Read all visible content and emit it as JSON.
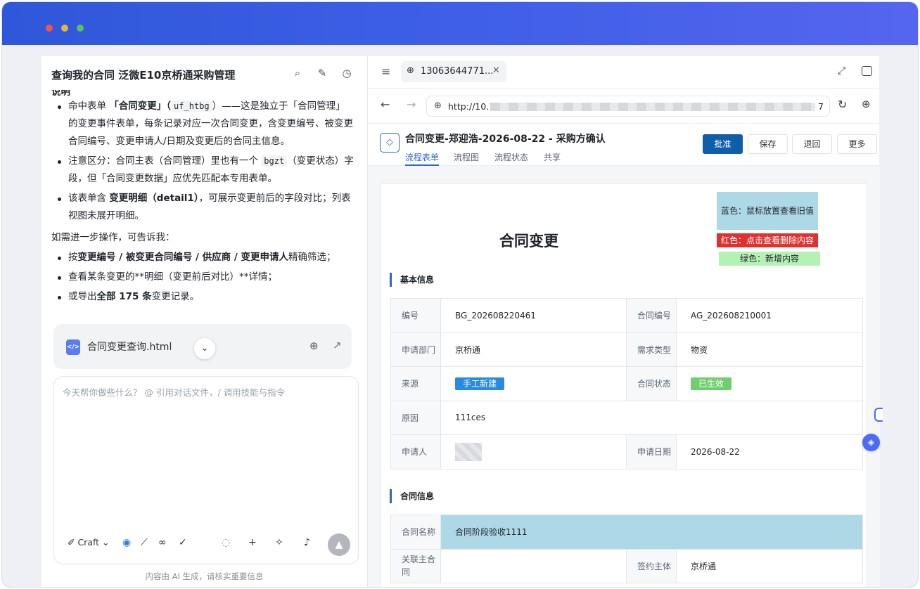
{
  "left_panel": {
    "title": "查询我的合同 泛微E10京桥通采购管理",
    "cut_heading": "说明",
    "bullets1": [
      {
        "pre": "命中表单 ",
        "bold": "「合同变更」（",
        "code": "uf_htbg",
        "post": "）——这是独立于「合同管理」的变更事件表单，每条记录对应一次合同变更，含变更编号、被变更合同编号、变更申请人/日期及变更后的合同主信息。"
      },
      {
        "pre": "注意区分：合同主表（合同管理）里也有一个 ",
        "code": "bgzt",
        "post": "（变更状态）字段，但「合同变更数据」应优先匹配本专用表单。"
      },
      {
        "pre": "该表单含 ",
        "bold": "变更明细（detail1）",
        "post": "，可展示变更前后的字段对比；列表视图未展开明细。"
      }
    ],
    "followup_intro": "如需进一步操作，可告诉我：",
    "bullets2": [
      {
        "pre": "按",
        "bold": "变更编号 / 被变更合同编号 / 供应商 / 变更申请人",
        "post": "精确筛选；"
      },
      {
        "pre": "查看某条变更的**明细（变更前后对比）**详情；",
        "bold": "",
        "post": ""
      },
      {
        "pre": "或导出",
        "bold": "全部 175 条",
        "post": "变更记录。"
      }
    ],
    "file_card": {
      "name": "合同变更查询.html",
      "icon": "code-file-icon"
    },
    "input_placeholder": "今天帮你做些什么？ @ 引用对话文件，/ 调用技能与指令",
    "mode_label": "Craft",
    "disclaimer": "内容由 AI 生成，请核实重要信息"
  },
  "browser": {
    "tab_label": "13063644771...",
    "url_start": "http://10.1",
    "url_end": "7"
  },
  "form": {
    "title": "合同变更-郑迎浩-2026-08-22 - 采购方确认",
    "tabs": [
      "流程表单",
      "流程图",
      "流程状态",
      "共享"
    ],
    "buttons": {
      "approve": "批准",
      "save": "保存",
      "return": "退回",
      "more": "更多"
    },
    "doc_title": "合同变更",
    "legend": {
      "blue": "蓝色：鼠标放置查看旧值",
      "red": "红色：点击查看删除内容",
      "green": "绿色：新增内容"
    },
    "section_basic": "基本信息",
    "basic": {
      "code_label": "编号",
      "code_value": "BG_202608220461",
      "contract_no_label": "合同编号",
      "contract_no_value": "AG_202608210001",
      "dept_label": "申请部门",
      "dept_value": "京桥通",
      "demand_label": "需求类型",
      "demand_value": "物资",
      "source_label": "来源",
      "source_value": "手工新建",
      "status_label": "合同状态",
      "status_value": "已生效",
      "reason_label": "原因",
      "reason_value": "111ces",
      "applicant_label": "申请人",
      "date_label": "申请日期",
      "date_value": "2026-08-22"
    },
    "section_contract": "合同信息",
    "contract": {
      "name_label": "合同名称",
      "name_value": "合同阶段验收1111",
      "related_label": "关联主合同",
      "party_label": "签约主体",
      "party_value": "京桥通"
    }
  },
  "colors": {
    "accent": "#0f5eaa",
    "titlebar": "#3e5fe6",
    "legend_blue": "#add8e6",
    "legend_red": "#e03131",
    "legend_green": "#b4f2b4"
  }
}
